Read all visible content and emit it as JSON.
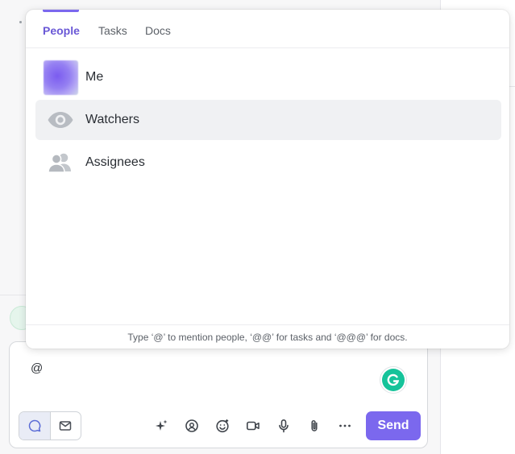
{
  "mention_popup": {
    "tabs": [
      {
        "label": "People",
        "active": true
      },
      {
        "label": "Tasks",
        "active": false
      },
      {
        "label": "Docs",
        "active": false
      }
    ],
    "options": [
      {
        "label": "Me",
        "icon": "avatar"
      },
      {
        "label": "Watchers",
        "icon": "eye-icon"
      },
      {
        "label": "Assignees",
        "icon": "people-icon"
      }
    ],
    "hint": "Type ‘@’ to mention people, ‘@@’ for tasks and ‘@@@’ for docs."
  },
  "composer": {
    "text": "@",
    "send_label": "Send",
    "tools": [
      "sparkle-icon",
      "mention-icon",
      "emoji-icon",
      "video-icon",
      "microphone-icon",
      "attachment-icon",
      "more-icon"
    ]
  },
  "colors": {
    "accent": "#7b68ee",
    "active_tab": "#6a58d6",
    "grammarly": "#15c39a",
    "hover_row": "#f0f1f3"
  }
}
